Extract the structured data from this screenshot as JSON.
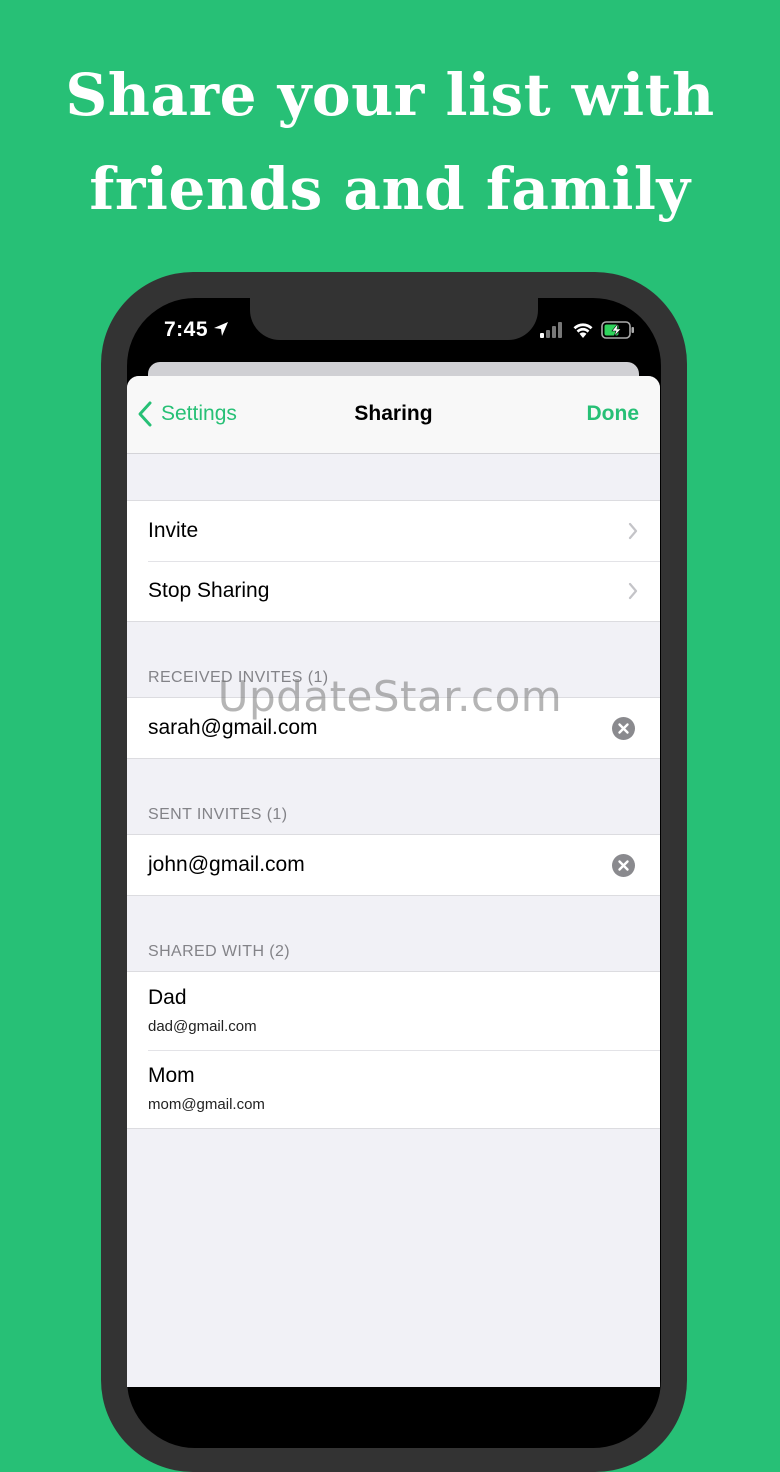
{
  "headline": {
    "line1": "Share your list with",
    "line2": "friends and family"
  },
  "status_bar": {
    "time": "7:45",
    "icons": [
      "location-arrow-icon",
      "cellular-signal-icon",
      "wifi-icon",
      "battery-charging-icon"
    ]
  },
  "nav": {
    "back_label": "Settings",
    "title": "Sharing",
    "done_label": "Done"
  },
  "actions": [
    {
      "label": "Invite"
    },
    {
      "label": "Stop Sharing"
    }
  ],
  "received_invites": {
    "header": "RECEIVED INVITES (1)",
    "items": [
      {
        "email": "sarah@gmail.com"
      }
    ]
  },
  "sent_invites": {
    "header": "SENT INVITES (1)",
    "items": [
      {
        "email": "john@gmail.com"
      }
    ]
  },
  "shared_with": {
    "header": "SHARED WITH (2)",
    "items": [
      {
        "name": "Dad",
        "email": "dad@gmail.com"
      },
      {
        "name": "Mom",
        "email": "mom@gmail.com"
      }
    ]
  },
  "watermark": "UpdateStar.com",
  "colors": {
    "background": "#27c076",
    "accent": "#27c076",
    "phone_frame": "#333333"
  }
}
